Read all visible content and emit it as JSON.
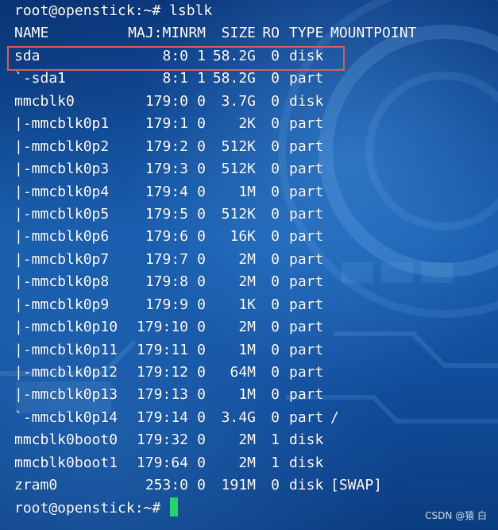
{
  "prompt_command": "root@openstick:~# lsblk",
  "prompt_final": "root@openstick:~# ",
  "headers": {
    "name": "NAME",
    "majmin": "MAJ:MIN",
    "rm": "RM",
    "size": "SIZE",
    "ro": "RO",
    "type": "TYPE",
    "mountpoint": "MOUNTPOINT"
  },
  "rows": [
    {
      "name": "sda",
      "majmin": "8:0",
      "rm": "1",
      "size": "58.2G",
      "ro": "0",
      "type": "disk",
      "mount": ""
    },
    {
      "name": "`-sda1",
      "majmin": "8:1",
      "rm": "1",
      "size": "58.2G",
      "ro": "0",
      "type": "part",
      "mount": ""
    },
    {
      "name": "mmcblk0",
      "majmin": "179:0",
      "rm": "0",
      "size": "3.7G",
      "ro": "0",
      "type": "disk",
      "mount": ""
    },
    {
      "name": "|-mmcblk0p1",
      "majmin": "179:1",
      "rm": "0",
      "size": "2K",
      "ro": "0",
      "type": "part",
      "mount": ""
    },
    {
      "name": "|-mmcblk0p2",
      "majmin": "179:2",
      "rm": "0",
      "size": "512K",
      "ro": "0",
      "type": "part",
      "mount": ""
    },
    {
      "name": "|-mmcblk0p3",
      "majmin": "179:3",
      "rm": "0",
      "size": "512K",
      "ro": "0",
      "type": "part",
      "mount": ""
    },
    {
      "name": "|-mmcblk0p4",
      "majmin": "179:4",
      "rm": "0",
      "size": "1M",
      "ro": "0",
      "type": "part",
      "mount": ""
    },
    {
      "name": "|-mmcblk0p5",
      "majmin": "179:5",
      "rm": "0",
      "size": "512K",
      "ro": "0",
      "type": "part",
      "mount": ""
    },
    {
      "name": "|-mmcblk0p6",
      "majmin": "179:6",
      "rm": "0",
      "size": "16K",
      "ro": "0",
      "type": "part",
      "mount": ""
    },
    {
      "name": "|-mmcblk0p7",
      "majmin": "179:7",
      "rm": "0",
      "size": "2M",
      "ro": "0",
      "type": "part",
      "mount": ""
    },
    {
      "name": "|-mmcblk0p8",
      "majmin": "179:8",
      "rm": "0",
      "size": "2M",
      "ro": "0",
      "type": "part",
      "mount": ""
    },
    {
      "name": "|-mmcblk0p9",
      "majmin": "179:9",
      "rm": "0",
      "size": "1K",
      "ro": "0",
      "type": "part",
      "mount": ""
    },
    {
      "name": "|-mmcblk0p10",
      "majmin": "179:10",
      "rm": "0",
      "size": "2M",
      "ro": "0",
      "type": "part",
      "mount": ""
    },
    {
      "name": "|-mmcblk0p11",
      "majmin": "179:11",
      "rm": "0",
      "size": "1M",
      "ro": "0",
      "type": "part",
      "mount": ""
    },
    {
      "name": "|-mmcblk0p12",
      "majmin": "179:12",
      "rm": "0",
      "size": "64M",
      "ro": "0",
      "type": "part",
      "mount": ""
    },
    {
      "name": "|-mmcblk0p13",
      "majmin": "179:13",
      "rm": "0",
      "size": "1M",
      "ro": "0",
      "type": "part",
      "mount": ""
    },
    {
      "name": "`-mmcblk0p14",
      "majmin": "179:14",
      "rm": "0",
      "size": "3.4G",
      "ro": "0",
      "type": "part",
      "mount": "/"
    },
    {
      "name": "mmcblk0boot0",
      "majmin": "179:32",
      "rm": "0",
      "size": "2M",
      "ro": "1",
      "type": "disk",
      "mount": ""
    },
    {
      "name": "mmcblk0boot1",
      "majmin": "179:64",
      "rm": "0",
      "size": "2M",
      "ro": "1",
      "type": "disk",
      "mount": ""
    },
    {
      "name": "zram0",
      "majmin": "253:0",
      "rm": "0",
      "size": "191M",
      "ro": "0",
      "type": "disk",
      "mount": "[SWAP]"
    }
  ],
  "watermark": "CSDN @猿 白",
  "colors": {
    "text": "#ffffff",
    "cursor": "#22d46a",
    "highlight_box": "#e05a5a",
    "background": "#0d3f86"
  }
}
